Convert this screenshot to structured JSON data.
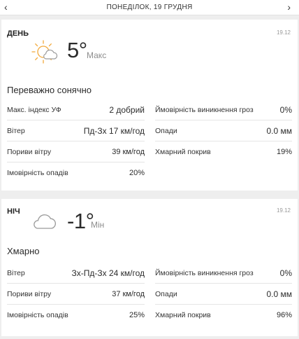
{
  "header": {
    "date": "Понеділок, 19 грудня",
    "prev_icon": "chevron-left-icon",
    "next_icon": "chevron-right-icon"
  },
  "day": {
    "label": "ДЕНЬ",
    "date": "19.12",
    "icon": "sun-cloud-icon",
    "temperature": "5°",
    "temperature_label": "Макс",
    "summary": "Переважно сонячно",
    "left": [
      {
        "label": "Макс. індекс УФ",
        "value": "2 добрий"
      },
      {
        "label": "Вітер",
        "value": "Пд-Зх 17 км/год"
      },
      {
        "label": "Пориви вітру",
        "value": "39 км/год"
      },
      {
        "label": "Імовірність опадів",
        "value": "20%"
      }
    ],
    "right": [
      {
        "label": "Ймовірність виникнення гроз",
        "value": "0%"
      },
      {
        "label": "Опади",
        "value": "0.0 мм"
      },
      {
        "label": "Хмарний покрив",
        "value": "19%"
      }
    ]
  },
  "night": {
    "label": "НІЧ",
    "date": "19.12",
    "icon": "cloud-icon",
    "temperature": "-1°",
    "temperature_label": "Мін",
    "summary": "Хмарно",
    "left": [
      {
        "label": "Вітер",
        "value": "Зх-Пд-Зх 24 км/год"
      },
      {
        "label": "Пориви вітру",
        "value": "37 км/год"
      },
      {
        "label": "Імовірність опадів",
        "value": "25%"
      }
    ],
    "right": [
      {
        "label": "Ймовірність виникнення гроз",
        "value": "0%"
      },
      {
        "label": "Опади",
        "value": "0.0 мм"
      },
      {
        "label": "Хмарний покрив",
        "value": "96%"
      }
    ]
  },
  "colors": {
    "sun": "#f2a93b",
    "cloud": "#9a9a9a",
    "muted": "#8d8d8d"
  }
}
